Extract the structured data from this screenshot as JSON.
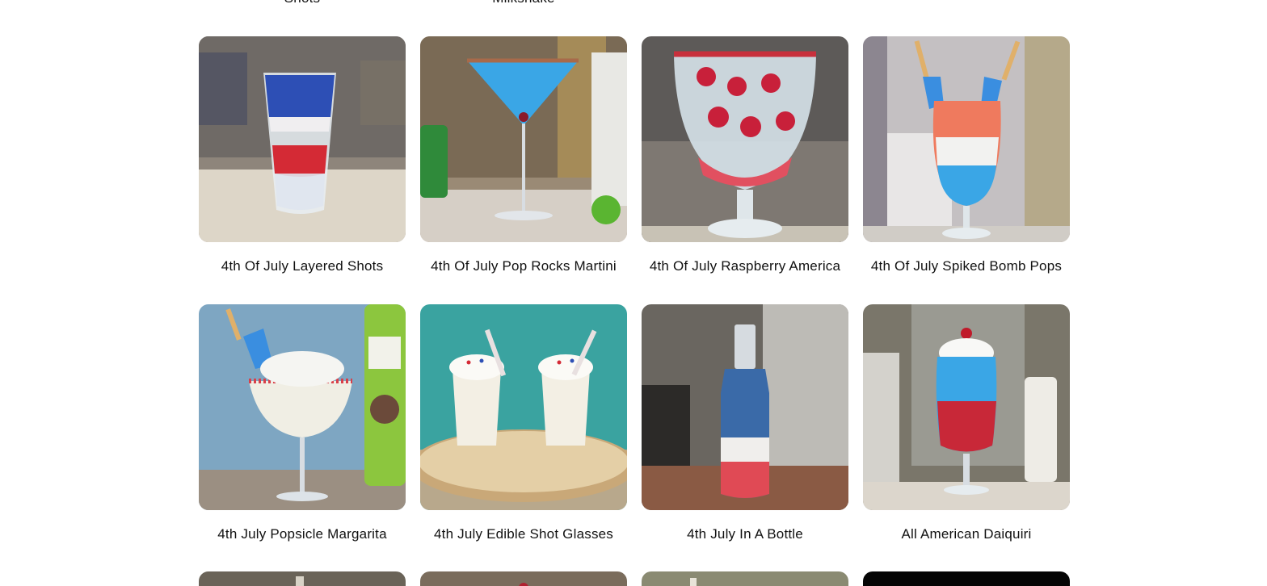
{
  "previous_row_labels": [
    "Shots",
    "Milkshake"
  ],
  "recipes": [
    {
      "title": "4th Of July Layered Shots"
    },
    {
      "title": "4th Of July Pop Rocks Martini"
    },
    {
      "title": "4th Of July Raspberry America"
    },
    {
      "title": "4th Of July Spiked Bomb Pops"
    },
    {
      "title": "4th July Popsicle Margarita"
    },
    {
      "title": "4th July Edible Shot Glasses"
    },
    {
      "title": "4th July In A Bottle"
    },
    {
      "title": "All American Daiquiri"
    }
  ],
  "colors": {
    "text": "#111111",
    "drink_red": "#d42a35",
    "drink_blue": "#3aa6e6",
    "drink_white": "#f4f1ee"
  }
}
